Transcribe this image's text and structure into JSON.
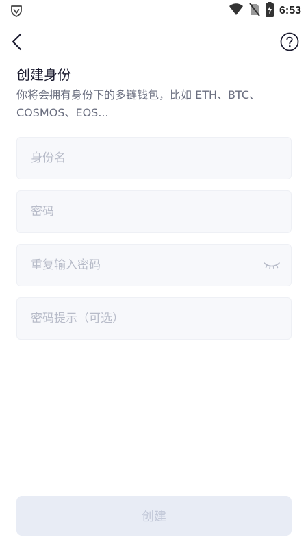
{
  "status_bar": {
    "time": "6:53",
    "icons": [
      "shield-outline-icon",
      "wifi-icon",
      "no-sim-icon",
      "battery-charging-icon"
    ]
  },
  "nav": {
    "back_icon": "chevron-left-icon",
    "help_icon": "question-circle-icon"
  },
  "header": {
    "title": "创建身份",
    "subtitle": "你将会拥有身份下的多链钱包，比如 ETH、BTC、COSMOS、EOS..."
  },
  "form": {
    "identity_name": {
      "placeholder": "身份名",
      "value": ""
    },
    "password": {
      "placeholder": "密码",
      "value": ""
    },
    "repeat_password": {
      "placeholder": "重复输入密码",
      "value": "",
      "toggle_icon": "eye-closed-icon"
    },
    "password_hint": {
      "placeholder": "密码提示（可选）",
      "value": ""
    }
  },
  "actions": {
    "create_label": "创建",
    "create_enabled": false
  },
  "colors": {
    "field_bg": "#f7f8fb",
    "placeholder": "#b8bcc9",
    "subtitle": "#6b6f80",
    "button_disabled_bg": "#e8ecf5",
    "button_disabled_text": "#c3c9d9"
  }
}
